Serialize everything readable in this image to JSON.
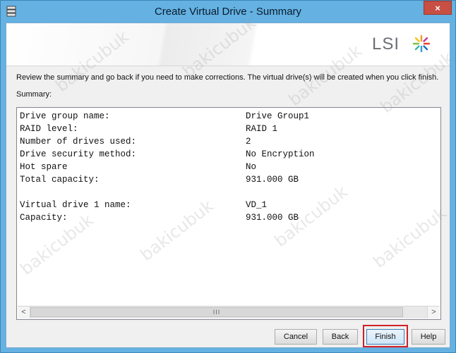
{
  "window": {
    "title": "Create Virtual Drive - Summary",
    "close_label": "×"
  },
  "banner": {
    "logo_text": "LSI"
  },
  "instructions": "Review the summary and go back if you need to make corrections. The virtual drive(s) will be created when you click finish.",
  "summary_label": "Summary:",
  "summary": {
    "drive_group": [
      {
        "key": "Drive group name:",
        "value": "Drive Group1"
      },
      {
        "key": "RAID level:",
        "value": "RAID 1"
      },
      {
        "key": "Number of drives used:",
        "value": "2"
      },
      {
        "key": "Drive security method:",
        "value": "No Encryption"
      },
      {
        "key": "Hot spare",
        "value": "No"
      },
      {
        "key": "Total capacity:",
        "value": "931.000 GB"
      }
    ],
    "virtual_drive": [
      {
        "key": "Virtual drive 1 name:",
        "value": "VD_1"
      },
      {
        "key": "Capacity:",
        "value": "931.000 GB"
      }
    ]
  },
  "scrollbar": {
    "left_arrow": "<",
    "right_arrow": ">",
    "grip": "III"
  },
  "buttons": {
    "cancel": "Cancel",
    "back": "Back",
    "finish": "Finish",
    "help": "Help"
  },
  "watermark": "bakicubuk",
  "colors": {
    "title_bar": "#64b1e2",
    "close_button": "#c74f44",
    "highlight": "#d0202a"
  }
}
